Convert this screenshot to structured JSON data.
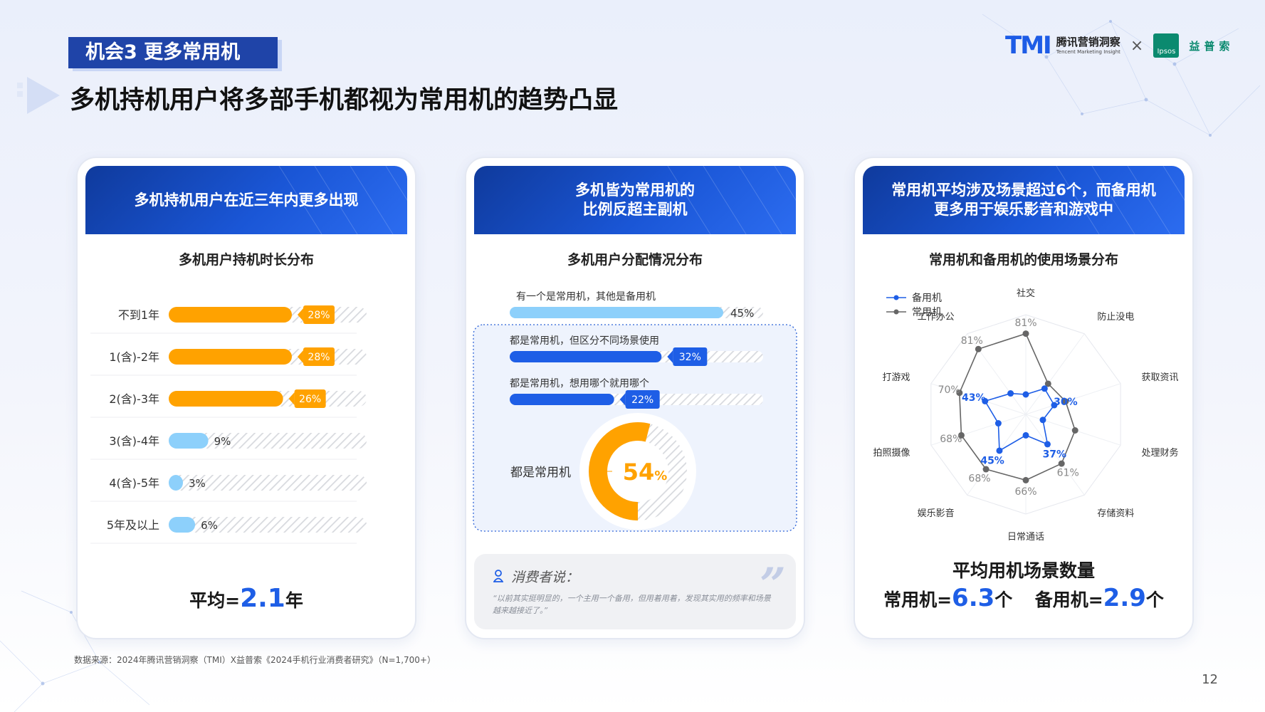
{
  "header": {
    "tag": "机会3  更多常用机",
    "title": "多机持机用户将多部手机都视为常用机的趋势凸显",
    "logo_tmi": "TMI",
    "logo_cn": "腾讯营销洞察",
    "logo_en": "Tencent Marketing Insight",
    "logo_x": "×",
    "logo_ipsos": "Ipsos",
    "logo_ipsos_cn": "益普索"
  },
  "colors": {
    "brand_blue": "#1e5ee6",
    "orange": "#ffa200",
    "light_blue": "#8dd0fb",
    "dark_blue": "#1f44a8"
  },
  "card1": {
    "head": "多机持机用户在近三年内更多出现",
    "subtitle": "多机用户持机时长分布",
    "avg_prefix": "平均=",
    "avg_value": "2.1",
    "avg_unit": "年"
  },
  "card2": {
    "head": "多机皆为常用机的\n比例反超主副机",
    "subtitle": "多机用户分配情况分布",
    "donut_label": "都是常用机",
    "quote_label": "消费者说：",
    "quote_text": "“以前其实挺明显的，一个主用一个备用，但用着用着，发现其实用的频率和场景越来越接近了。”"
  },
  "card3": {
    "head": "常用机平均涉及场景超过6个，而备用机\n更多用于娱乐影音和游戏中",
    "subtitle": "常用机和备用机的使用场景分布",
    "avg_title": "平均用机场景数量",
    "avg_label_a": "常用机=",
    "avg_value_a": "6.3",
    "avg_unit_a": "个",
    "avg_label_b": "备用机=",
    "avg_value_b": "2.9",
    "avg_unit_b": "个"
  },
  "chart_data": [
    {
      "type": "bar",
      "orientation": "horizontal",
      "title": "多机用户持机时长分布",
      "categories": [
        "不到1年",
        "1(含)-2年",
        "2(含)-3年",
        "3(含)-4年",
        "4(含)-5年",
        "5年及以上"
      ],
      "values": [
        28,
        28,
        26,
        9,
        3,
        6
      ],
      "labels": [
        "28%",
        "28%",
        "26%",
        "9%",
        "3%",
        "6%"
      ],
      "xlim": [
        0,
        45
      ],
      "bar_colors": [
        "#ffa200",
        "#ffa200",
        "#ffa200",
        "#8dd0fb",
        "#8dd0fb",
        "#8dd0fb"
      ]
    },
    {
      "type": "bar",
      "orientation": "horizontal",
      "title": "多机用户分配情况分布",
      "categories": [
        "有一个是常用机，其他是备用机",
        "都是常用机，但区分不同场景使用",
        "都是常用机，想用哪个就用哪个"
      ],
      "values": [
        45,
        32,
        22
      ],
      "labels": [
        "45%",
        "32%",
        "22%"
      ],
      "xlim": [
        0,
        45
      ],
      "bar_colors": [
        "#8dd0fb",
        "#1e5ee6",
        "#1e5ee6"
      ],
      "donut": {
        "label": "都是常用机",
        "value": 54,
        "display_number": "54",
        "display_unit": "%"
      }
    },
    {
      "type": "radar",
      "title": "常用机和备用机的使用场景分布",
      "categories": [
        "社交",
        "防止没电",
        "获取资讯",
        "处理财务",
        "存储资料",
        "日常通话",
        "娱乐影音",
        "拍照摄像",
        "打游戏",
        "工作办公"
      ],
      "series": [
        {
          "name": "备用机",
          "color": "#1e5ee6",
          "values": [
            20,
            32,
            30,
            18,
            37,
            21,
            45,
            29,
            43,
            26
          ],
          "labels": [
            "",
            "",
            "30%",
            "",
            "37%",
            "",
            "45%",
            "",
            "43%",
            ""
          ]
        },
        {
          "name": "常用机",
          "color": "#666666",
          "values": [
            81,
            38,
            42,
            52,
            61,
            66,
            68,
            68,
            70,
            81
          ],
          "labels": [
            "81%",
            "",
            "",
            "",
            "61%",
            "66%",
            "68%",
            "68%",
            "70%",
            "81%"
          ]
        }
      ],
      "legend_position": "top-left",
      "rlim": [
        0,
        100
      ]
    }
  ],
  "footer": {
    "source": "数据来源：2024年腾讯营销洞察（TMI）X益普索《2024手机行业消费者研究》（N=1,700+）",
    "page": "12"
  }
}
